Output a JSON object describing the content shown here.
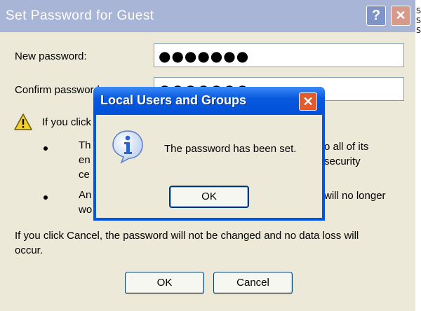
{
  "outer_dialog": {
    "title": "Set Password for Guest",
    "help_button": "?",
    "close_button": "✕",
    "new_password_label": "New password:",
    "new_password_value": "●●●●●●●",
    "confirm_password_label": "Confirm password:",
    "confirm_password_value": "●●●●●●●",
    "warning_intro": "If you click",
    "bullet1_lines": [
      "Th",
      "en",
      "ce"
    ],
    "bullet1_right_lines": [
      "o all of its",
      "security"
    ],
    "bullet2_lines": [
      "An",
      "wo"
    ],
    "bullet2_right_lines": [
      "will no longer"
    ],
    "cancel_note_line1": "If you click Cancel, the password will not be changed and no data loss will",
    "cancel_note_line2": "occur.",
    "ok_button": "OK",
    "cancel_button": "Cancel",
    "right_edge_chars": [
      "S",
      "S",
      "S"
    ]
  },
  "message_box": {
    "title": "Local Users and Groups",
    "close_button": "✕",
    "icon": "info-icon",
    "message": "The password has been set.",
    "ok_button": "OK"
  },
  "colors": {
    "outer_title_bar": "#a8b5d6",
    "dialog_face": "#ece9d8",
    "msg_title_bar": "#0050d8",
    "msg_close": "#e35a2c",
    "info_blue": "#2a63d6"
  }
}
